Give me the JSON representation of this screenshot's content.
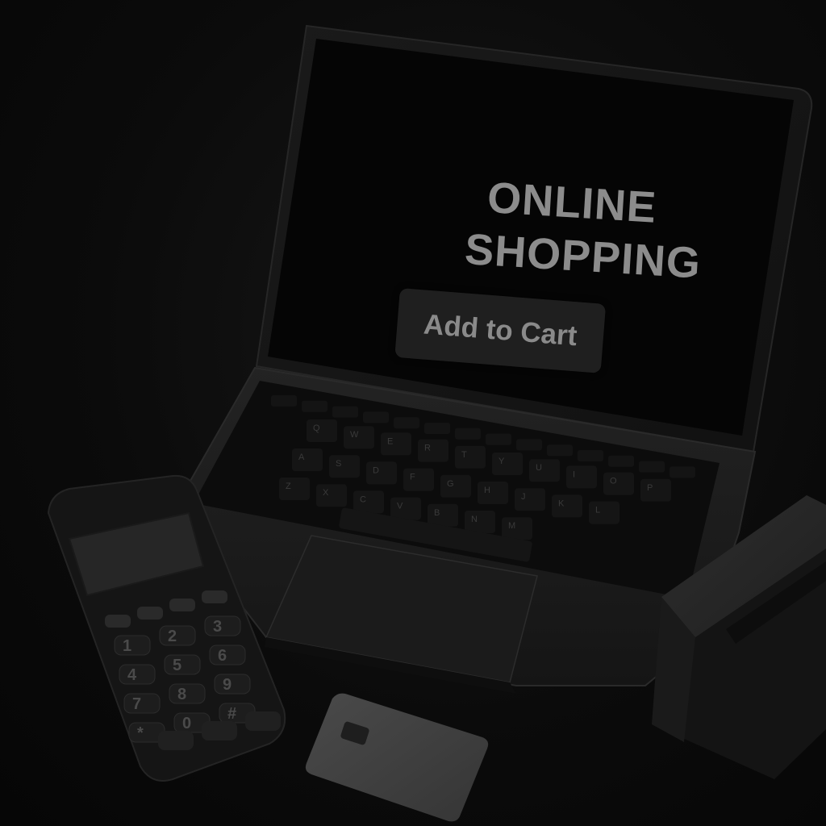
{
  "laptop_screen": {
    "headline_line1": "ONLINE",
    "headline_line2": "SHOPPING",
    "add_to_cart_label": "Add to Cart"
  },
  "keyboard": {
    "row1": [
      "Q",
      "W",
      "E",
      "R",
      "T",
      "Y",
      "U",
      "I",
      "O",
      "P"
    ],
    "row2": [
      "A",
      "S",
      "D",
      "F",
      "G",
      "H",
      "J",
      "K",
      "L"
    ],
    "row3": [
      "Z",
      "X",
      "C",
      "V",
      "B",
      "N",
      "M"
    ]
  },
  "payment_terminal": {
    "keys": [
      "1",
      "2",
      "3",
      "4",
      "5",
      "6",
      "7",
      "8",
      "9",
      "*",
      "0",
      "#"
    ]
  },
  "colors": {
    "background": "#0a0a0a",
    "screen_text": "#8c8c8c",
    "button_bg": "#1f1f1f"
  }
}
